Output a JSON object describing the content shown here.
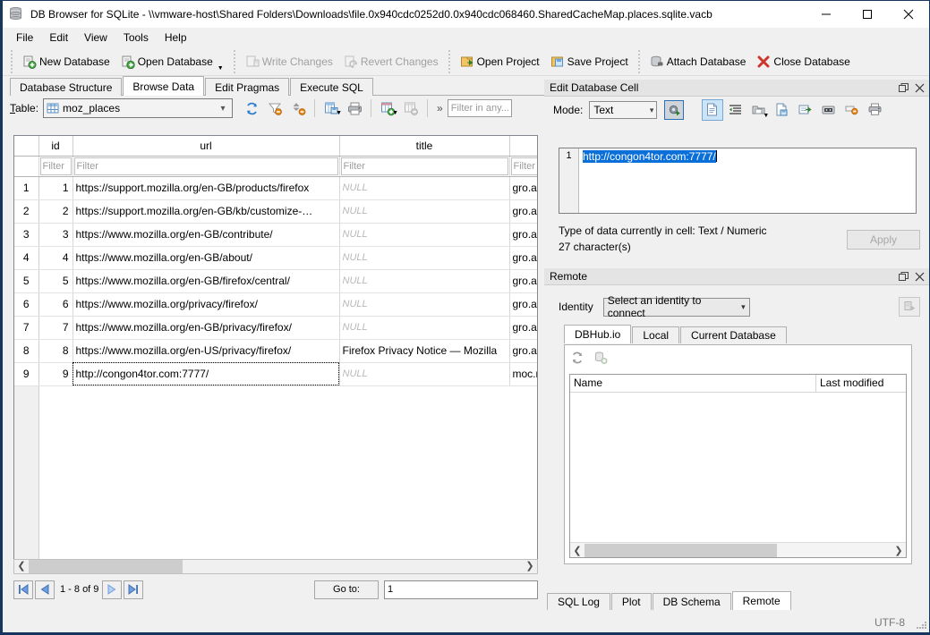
{
  "window": {
    "title": "DB Browser for SQLite - \\\\vmware-host\\Shared Folders\\Downloads\\file.0x940cdc0252d0.0x940cdc068460.SharedCacheMap.places.sqlite.vacb",
    "app_icon": "database-icon",
    "minimize": "—",
    "maximize": "☐",
    "close": "✕"
  },
  "menubar": {
    "items": [
      {
        "label": "File"
      },
      {
        "label": "Edit"
      },
      {
        "label": "View"
      },
      {
        "label": "Tools"
      },
      {
        "label": "Help"
      }
    ]
  },
  "toolbar": {
    "buttons": [
      {
        "label": "New Database",
        "icon": "new-database-icon",
        "disabled": false
      },
      {
        "label": "Open Database",
        "icon": "open-database-icon",
        "disabled": false,
        "dropdown": true
      },
      {
        "label": "Write Changes",
        "icon": "write-changes-icon",
        "disabled": true
      },
      {
        "label": "Revert Changes",
        "icon": "revert-changes-icon",
        "disabled": true
      },
      {
        "label": "Open Project",
        "icon": "open-project-icon",
        "disabled": false
      },
      {
        "label": "Save Project",
        "icon": "save-project-icon",
        "disabled": false
      },
      {
        "label": "Attach Database",
        "icon": "attach-database-icon",
        "disabled": false
      },
      {
        "label": "Close Database",
        "icon": "close-database-icon",
        "disabled": false
      }
    ]
  },
  "main_tabs": [
    {
      "label": "Database Structure",
      "active": false
    },
    {
      "label": "Browse Data",
      "active": true
    },
    {
      "label": "Edit Pragmas",
      "active": false
    },
    {
      "label": "Execute SQL",
      "active": false
    }
  ],
  "browse_bar": {
    "table_label": "Table:",
    "table_value": "moz_places",
    "table_icon": "table-icon",
    "icons": [
      "refresh-icon",
      "clear-filters-icon",
      "clear-sorting-icon",
      "save-results-icon",
      "print-icon",
      "insert-record-icon",
      "delete-record-icon"
    ],
    "more_chevron": "»",
    "filter_placeholder": "Filter in any..."
  },
  "grid": {
    "columns": [
      {
        "key": "rownum",
        "label": ""
      },
      {
        "key": "id",
        "label": "id"
      },
      {
        "key": "url",
        "label": "url"
      },
      {
        "key": "title",
        "label": "title"
      },
      {
        "key": "host",
        "label": ""
      }
    ],
    "filter_placeholder": "Filter",
    "rows": [
      {
        "rownum": "1",
        "id": "1",
        "url": "https://support.mozilla.org/en-GB/products/firefox",
        "title": "NULL",
        "title_null": true,
        "host": "gro.al"
      },
      {
        "rownum": "2",
        "id": "2",
        "url": "https://support.mozilla.org/en-GB/kb/customize-…",
        "title": "NULL",
        "title_null": true,
        "host": "gro.al"
      },
      {
        "rownum": "3",
        "id": "3",
        "url": "https://www.mozilla.org/en-GB/contribute/",
        "title": "NULL",
        "title_null": true,
        "host": "gro.al"
      },
      {
        "rownum": "4",
        "id": "4",
        "url": "https://www.mozilla.org/en-GB/about/",
        "title": "NULL",
        "title_null": true,
        "host": "gro.al"
      },
      {
        "rownum": "5",
        "id": "5",
        "url": "https://www.mozilla.org/en-GB/firefox/central/",
        "title": "NULL",
        "title_null": true,
        "host": "gro.al"
      },
      {
        "rownum": "6",
        "id": "6",
        "url": "https://www.mozilla.org/privacy/firefox/",
        "title": "NULL",
        "title_null": true,
        "host": "gro.al"
      },
      {
        "rownum": "7",
        "id": "7",
        "url": "https://www.mozilla.org/en-GB/privacy/firefox/",
        "title": "NULL",
        "title_null": true,
        "host": "gro.al"
      },
      {
        "rownum": "8",
        "id": "8",
        "url": "https://www.mozilla.org/en-US/privacy/firefox/",
        "title": "Firefox Privacy Notice — Mozilla",
        "title_null": false,
        "host": "gro.al"
      },
      {
        "rownum": "9",
        "id": "9",
        "url": "http://congon4tor.com:7777/",
        "title": "NULL",
        "title_null": true,
        "host": "moc.n",
        "selected": true
      }
    ]
  },
  "pager": {
    "first_icon": "first-page-icon",
    "prev_icon": "previous-page-icon",
    "range_label": "1 - 8 of 9",
    "next_icon": "next-page-icon",
    "last_icon": "last-page-icon",
    "goto_label": "Go to:",
    "goto_value": "1"
  },
  "edit_cell_panel": {
    "title": "Edit Database Cell",
    "float_icon": "float-panel-icon",
    "close_icon": "close-panel-icon",
    "mode_label": "Mode:",
    "mode_value": "Text",
    "apply_settings_icon": "apply-data-icon",
    "tool_icons": [
      "text-mode-icon",
      "word-wrap-icon",
      "import-data-icon",
      "export-data-icon",
      "set-as-null-icon",
      "open-in-external-icon",
      "remove-formatting-icon",
      "print-cell-icon"
    ],
    "editor_line_number": "1",
    "editor_value": "http://congon4tor.com:7777/",
    "type_info": "Type of data currently in cell: Text / Numeric",
    "char_info": "27 character(s)",
    "apply_label": "Apply"
  },
  "remote_panel": {
    "title": "Remote",
    "float_icon": "float-panel-icon",
    "close_icon": "close-panel-icon",
    "identity_label": "Identity",
    "identity_value": "Select an identity to connect",
    "connect_icon": "connect-identity-icon",
    "tabs": [
      {
        "label": "DBHub.io",
        "active": true
      },
      {
        "label": "Local",
        "active": false
      },
      {
        "label": "Current Database",
        "active": false
      }
    ],
    "tool_icons": [
      "refresh-remote-icon",
      "clone-database-icon"
    ],
    "list_headers": {
      "name": "Name",
      "last_modified": "Last modified"
    },
    "list_rows": []
  },
  "bottom_tabs": [
    {
      "label": "SQL Log",
      "active": false
    },
    {
      "label": "Plot",
      "active": false
    },
    {
      "label": "DB Schema",
      "active": false
    },
    {
      "label": "Remote",
      "active": true
    }
  ],
  "statusbar": {
    "encoding": "UTF-8"
  }
}
